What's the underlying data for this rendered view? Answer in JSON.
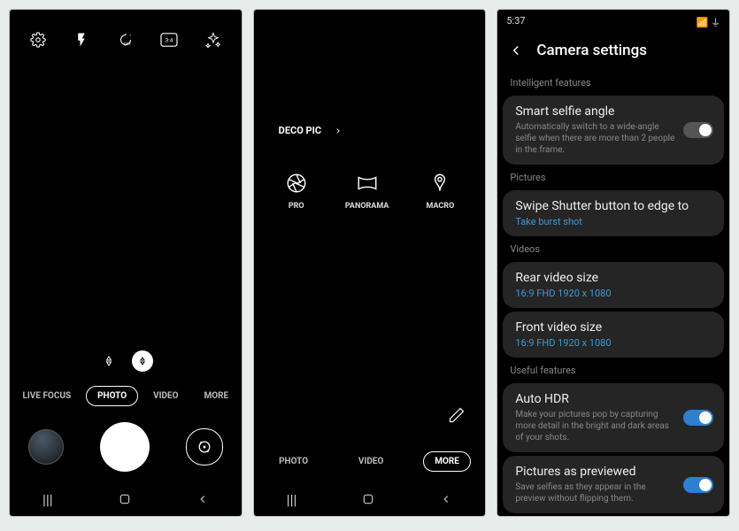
{
  "phone1": {
    "topbar": {
      "settings": "gear-icon",
      "flash": "flash-auto-icon",
      "timer": "timer-off-icon",
      "ratio": "3:4",
      "filters": "filters-icon"
    },
    "zoom": {
      "wide": "wide-icon",
      "normal": "normal-icon"
    },
    "modes": {
      "livefocus": "LIVE FOCUS",
      "photo": "PHOTO",
      "video": "VIDEO",
      "more": "MORE"
    },
    "nav": {
      "recent": "recent-icon",
      "home": "home-icon",
      "back": "back-icon"
    }
  },
  "phone2": {
    "deco": "DECO PIC",
    "modes": [
      {
        "icon": "aperture-icon",
        "label": "PRO"
      },
      {
        "icon": "panorama-icon",
        "label": "PANORAMA"
      },
      {
        "icon": "macro-icon",
        "label": "MACRO"
      }
    ],
    "bottom": {
      "photo": "PHOTO",
      "video": "VIDEO",
      "more": "MORE"
    }
  },
  "phone3": {
    "time": "5:37",
    "header": "Camera settings",
    "sections": {
      "intelligent": "Intelligent features",
      "pictures": "Pictures",
      "videos": "Videos",
      "useful": "Useful features"
    },
    "items": {
      "smartselfie": {
        "title": "Smart selfie angle",
        "desc": "Automatically switch to a wide-angle selfie when there are more than 2 people in the frame."
      },
      "swipeshutter": {
        "title": "Swipe Shutter button to edge to",
        "value": "Take burst shot"
      },
      "rearvideo": {
        "title": "Rear video size",
        "value": "16:9 FHD 1920 x 1080"
      },
      "frontvideo": {
        "title": "Front video size",
        "value": "16:9 FHD 1920 x 1080"
      },
      "autohdr": {
        "title": "Auto HDR",
        "desc": "Make your pictures pop by capturing more detail in the bright and dark areas of your shots."
      },
      "previewed": {
        "title": "Pictures as previewed",
        "desc": "Save selfies as they appear in the preview without flipping them."
      }
    }
  }
}
